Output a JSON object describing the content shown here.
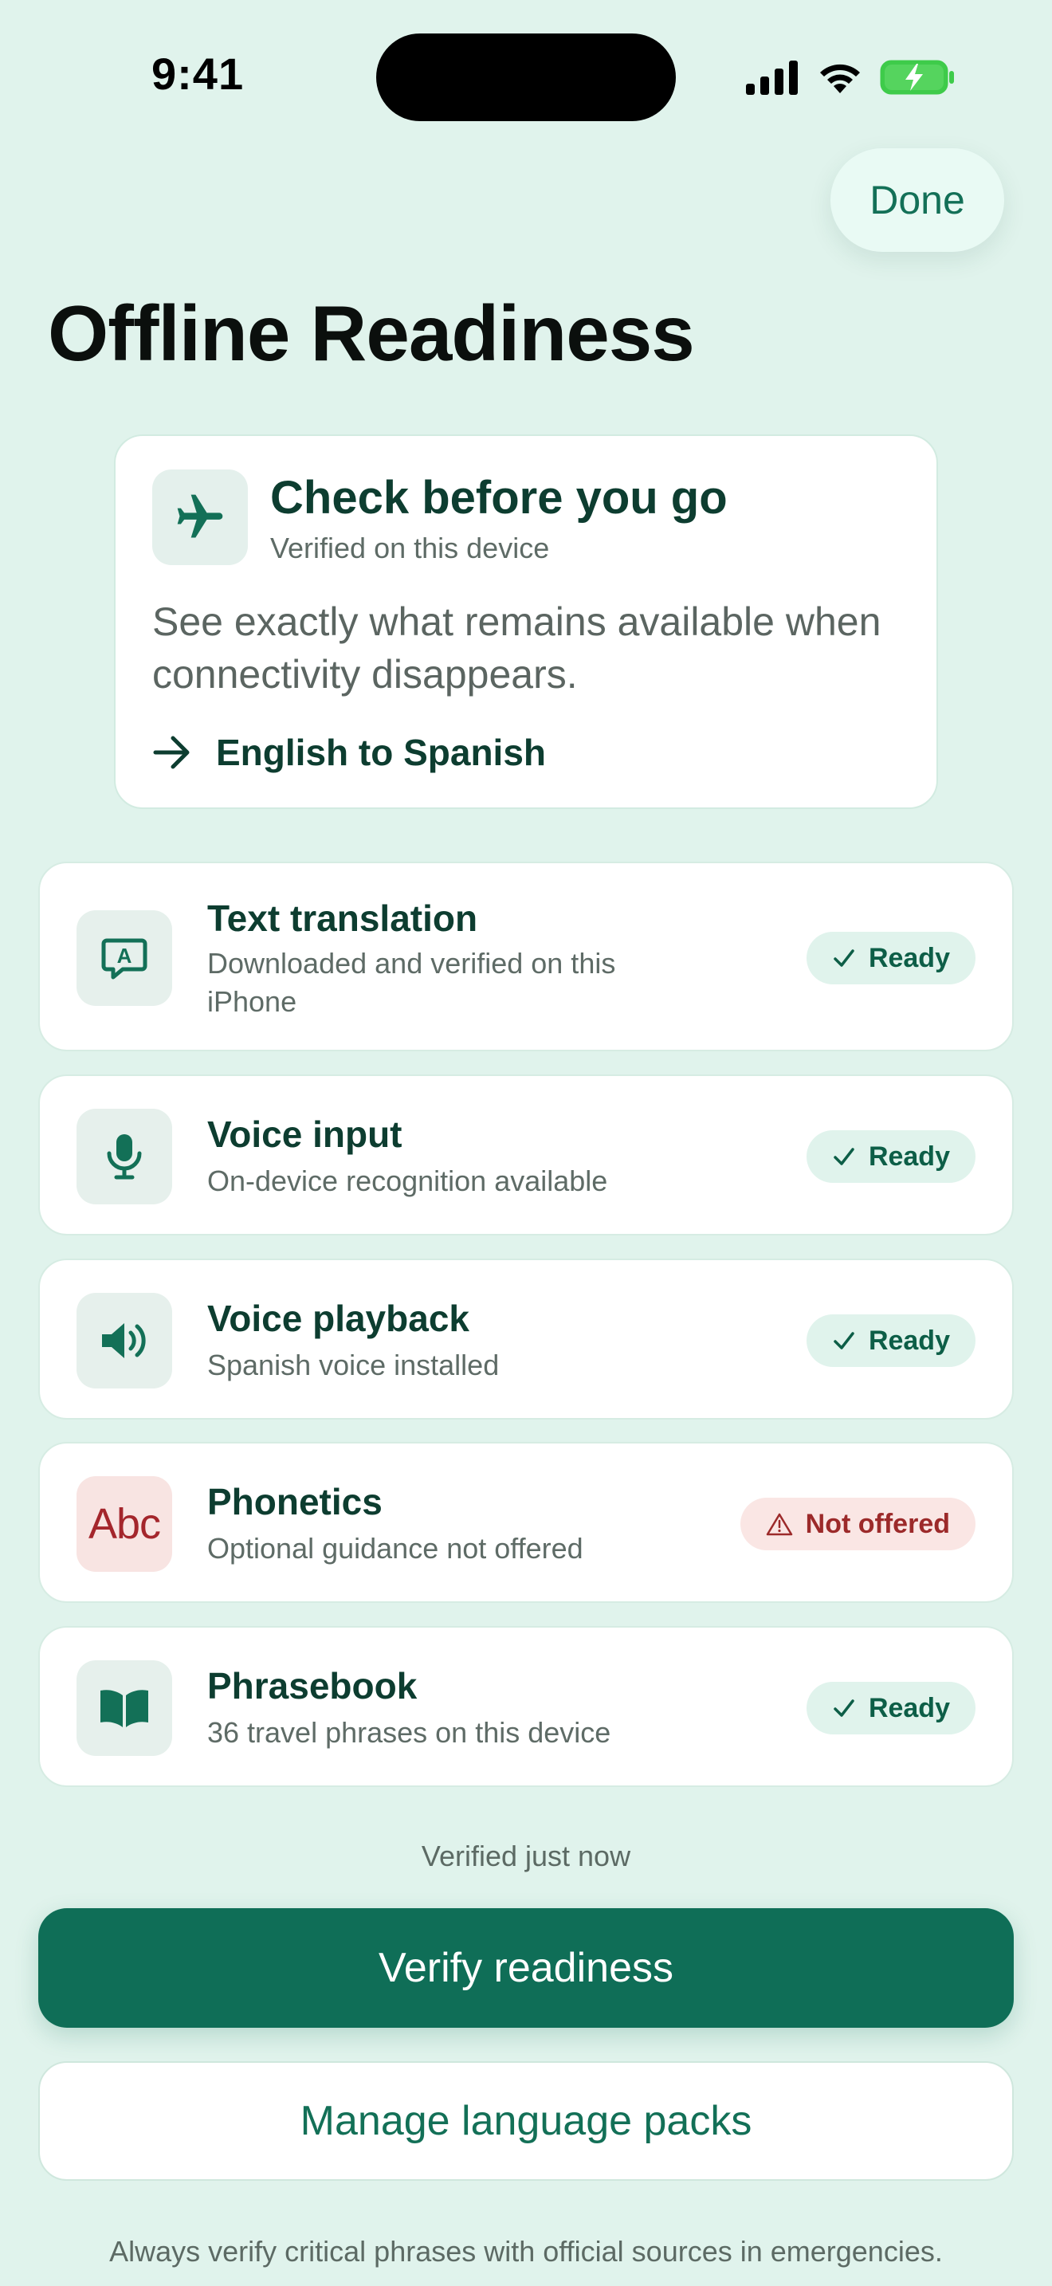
{
  "status_bar": {
    "time": "9:41"
  },
  "header": {
    "done_label": "Done",
    "title": "Offline Readiness"
  },
  "hero": {
    "title": "Check before you go",
    "subtitle": "Verified on this device",
    "description": "See exactly what remains available when connectivity disappears.",
    "language_pair": "English to Spanish"
  },
  "features": [
    {
      "title": "Text translation",
      "subtitle": "Downloaded and verified on this iPhone",
      "status": "Ready",
      "icon": "translate-bubble-icon"
    },
    {
      "title": "Voice input",
      "subtitle": "On-device recognition available",
      "status": "Ready",
      "icon": "microphone-icon"
    },
    {
      "title": "Voice playback",
      "subtitle": "Spanish voice installed",
      "status": "Ready",
      "icon": "speaker-icon"
    },
    {
      "title": "Phonetics",
      "subtitle": "Optional guidance not offered",
      "status": "Not offered",
      "icon_text": "Abc",
      "icon": "abc-icon"
    },
    {
      "title": "Phrasebook",
      "subtitle": "36 travel phrases on this device",
      "status": "Ready",
      "icon": "book-icon"
    }
  ],
  "verified_note": "Verified just now",
  "actions": {
    "verify_label": "Verify readiness",
    "manage_label": "Manage language packs"
  },
  "footer_note": "Always verify critical phrases with official sources in emergencies.",
  "colors": {
    "accent": "#0f6e57",
    "background": "#e0f3ec",
    "warning": "#a4262c"
  }
}
